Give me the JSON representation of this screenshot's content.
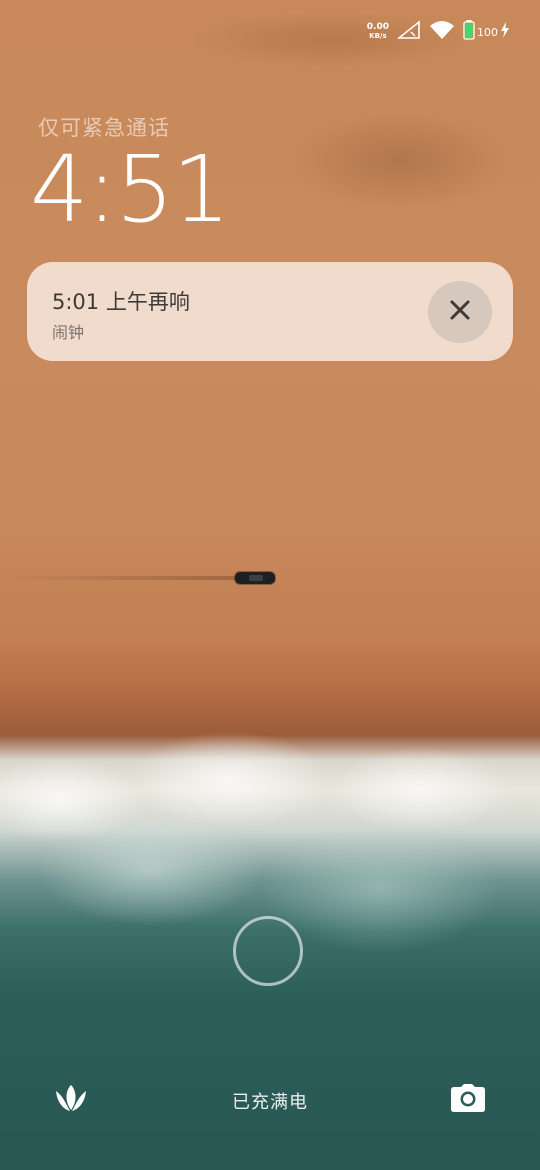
{
  "status_bar": {
    "net_speed_value": "0.00",
    "net_speed_unit": "KB/s",
    "battery_percent": "100",
    "icons": [
      "network-speed",
      "cellular-signal-icon",
      "wifi-icon",
      "battery-icon",
      "charging-bolt-icon"
    ]
  },
  "lock_screen": {
    "emergency_text": "仅可紧急通话",
    "time": "4:51",
    "charging_text": "已充满电"
  },
  "notification": {
    "title": "5:01 上午再响",
    "app_name": "闹钟",
    "dismiss_icon": "close-icon"
  },
  "shortcuts": {
    "left_icon": "lotus-icon",
    "right_icon": "camera-icon"
  },
  "colors": {
    "notification_bg": "#f4e2d6",
    "battery_green": "#3ddc6a",
    "text_white": "#ffffff"
  }
}
